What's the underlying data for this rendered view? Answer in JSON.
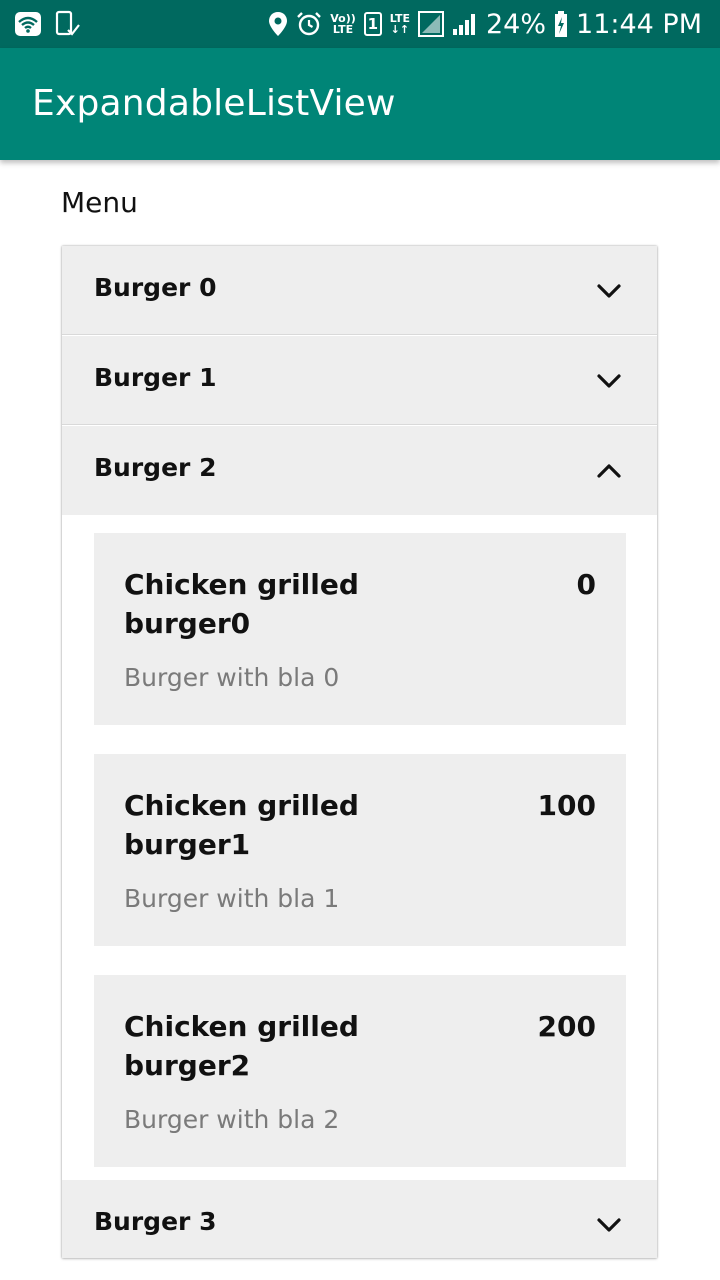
{
  "status_bar": {
    "volte_top": "Vo))",
    "volte_bottom": "LTE",
    "sim_number": "1",
    "lte_top": "LTE",
    "lte_bottom": "↓↑",
    "battery_percent": "24%",
    "time": "11:44 PM",
    "icons": [
      "wifi-icon",
      "phone-check-icon",
      "location-pin-icon",
      "alarm-icon",
      "signal-icon",
      "battery-charging-icon"
    ]
  },
  "app_bar": {
    "title": "ExpandableListView"
  },
  "menu": {
    "title": "Menu",
    "groups": [
      {
        "label": "Burger 0",
        "expanded": false,
        "icon": "chevron-down-icon"
      },
      {
        "label": "Burger 1",
        "expanded": false,
        "icon": "chevron-down-icon"
      },
      {
        "label": "Burger 2",
        "expanded": true,
        "icon": "chevron-up-icon",
        "children": [
          {
            "name": "Chicken grilled burger0",
            "price": "0",
            "description": "Burger with bla 0"
          },
          {
            "name": "Chicken grilled burger1",
            "price": "100",
            "description": "Burger with bla 1"
          },
          {
            "name": "Chicken grilled burger2",
            "price": "200",
            "description": "Burger with bla 2"
          }
        ]
      },
      {
        "label": "Burger 3",
        "expanded": false,
        "icon": "chevron-down-icon"
      }
    ]
  },
  "colors": {
    "status_bar": "#00695f",
    "app_bar": "#008577",
    "group_background": "#eeeeee",
    "description_text": "#7a7a7a"
  }
}
